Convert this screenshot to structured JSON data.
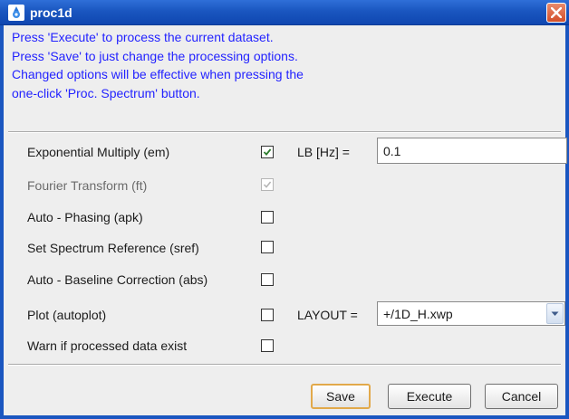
{
  "window": {
    "title": "proc1d",
    "icon": "app-logo-icon",
    "close_icon": "close-icon"
  },
  "info_lines": [
    "Press 'Execute' to process the current dataset.",
    "Press 'Save' to just change the processing options.",
    "Changed options will be effective when pressing the",
    "one-click 'Proc. Spectrum' button."
  ],
  "options": [
    {
      "label": "Exponential Multiply (em)",
      "checked": true,
      "enabled": true
    },
    {
      "label": "Fourier Transform (ft)",
      "checked": true,
      "enabled": false
    },
    {
      "label": "Auto - Phasing (apk)",
      "checked": false,
      "enabled": true
    },
    {
      "label": "Set Spectrum Reference (sref)",
      "checked": false,
      "enabled": true
    },
    {
      "label": "Auto - Baseline Correction (abs)",
      "checked": false,
      "enabled": true
    },
    {
      "label": "Plot (autoplot)",
      "checked": false,
      "enabled": true
    },
    {
      "label": "Warn if processed data exist",
      "checked": false,
      "enabled": true
    }
  ],
  "lb": {
    "label": "LB [Hz] =",
    "value": "0.1"
  },
  "layout": {
    "label": "LAYOUT =",
    "value": "+/1D_H.xwp"
  },
  "buttons": {
    "save": "Save",
    "execute": "Execute",
    "cancel": "Cancel"
  },
  "colors": {
    "info_text": "#2323ff",
    "title_bar": "#1a56c0",
    "default_button_border": "#e2a94a"
  }
}
